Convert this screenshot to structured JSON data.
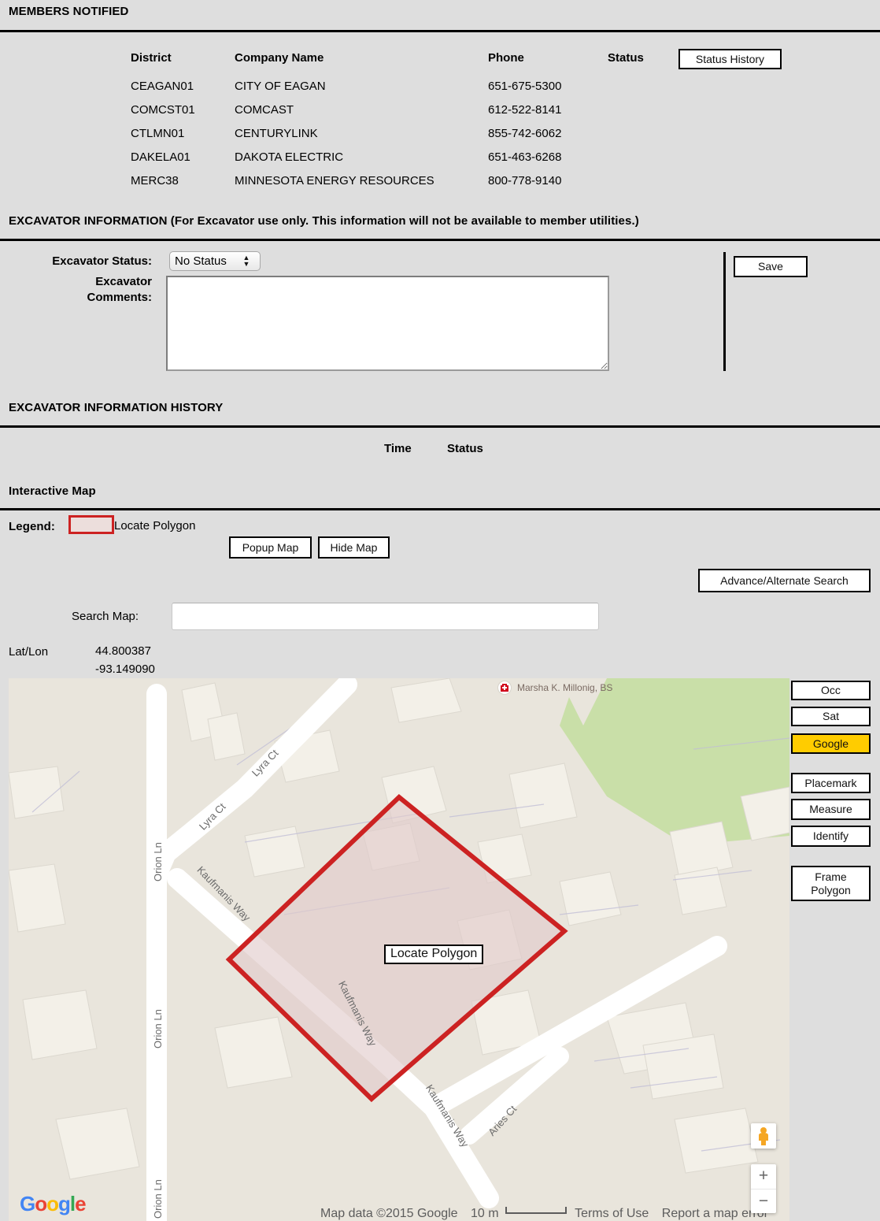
{
  "members": {
    "section_title": "MEMBERS NOTIFIED",
    "columns": [
      "District",
      "Company Name",
      "Phone",
      "Status"
    ],
    "status_history_label": "Status History",
    "rows": [
      {
        "district": "CEAGAN01",
        "company": "CITY OF EAGAN",
        "phone": "651-675-5300",
        "status": ""
      },
      {
        "district": "COMCST01",
        "company": "COMCAST",
        "phone": "612-522-8141",
        "status": ""
      },
      {
        "district": "CTLMN01",
        "company": "CENTURYLINK",
        "phone": "855-742-6062",
        "status": ""
      },
      {
        "district": "DAKELA01",
        "company": "DAKOTA ELECTRIC",
        "phone": "651-463-6268",
        "status": ""
      },
      {
        "district": "MERC38",
        "company": "MINNESOTA ENERGY RESOURCES",
        "phone": "800-778-9140",
        "status": ""
      }
    ]
  },
  "excavator": {
    "section_title": "EXCAVATOR INFORMATION (For Excavator use only. This information will not be available to member utilities.)",
    "status_label": "Excavator Status:",
    "status_value": "No Status",
    "status_options": [
      "No Status"
    ],
    "comments_label_line1": "Excavator",
    "comments_label_line2": "Comments:",
    "comments_value": "",
    "comments_placeholder": "",
    "save_label": "Save"
  },
  "excavator_history": {
    "section_title": "EXCAVATOR INFORMATION HISTORY",
    "columns": [
      "Time",
      "Status"
    ],
    "rows": []
  },
  "map_section": {
    "section_title": "Interactive Map",
    "legend_label": "Legend:",
    "legend_item": "Locate Polygon",
    "popup_map_label": "Popup Map",
    "hide_map_label": "Hide Map",
    "advance_search_label": "Advance/Alternate Search",
    "search_label": "Search Map:",
    "search_value": "",
    "search_placeholder": "",
    "latlon_label": "Lat/Lon",
    "lat": "44.800387",
    "lon": "-93.149090"
  },
  "map": {
    "controls": [
      {
        "label": "Occ",
        "active": false
      },
      {
        "label": "Sat",
        "active": false
      },
      {
        "label": "Google",
        "active": true
      },
      {
        "label": "Placemark",
        "active": false
      },
      {
        "label": "Measure",
        "active": false
      },
      {
        "label": "Identify",
        "active": false
      },
      {
        "label": "Frame Polygon",
        "active": false
      }
    ],
    "polygon_label": "Locate Polygon",
    "poi_label": "Marsha K. Millonig, BS",
    "streets": [
      "Lyra Ct",
      "Lyra Ct",
      "Orion Ln",
      "Orion Ln",
      "Orion Ln",
      "Kaufmanis Way",
      "Kaufmanis Way",
      "Kaufmanis Way",
      "Aries Ct"
    ],
    "attribution": {
      "map_data": "Map data ©2015 Google",
      "scale": "10 m",
      "terms": "Terms of Use",
      "report": "Report a map error",
      "logo": "Google"
    },
    "zoom_in": "+",
    "zoom_out": "−"
  },
  "colors": {
    "page_bg": "#dedede",
    "polygon_stroke": "#cc2222",
    "polygon_fill": "#e8d6d4",
    "active_button": "#ffcc00",
    "map_bg": "#e9e5dc",
    "park_green": "#c9dfa8",
    "road_white": "#ffffff"
  }
}
